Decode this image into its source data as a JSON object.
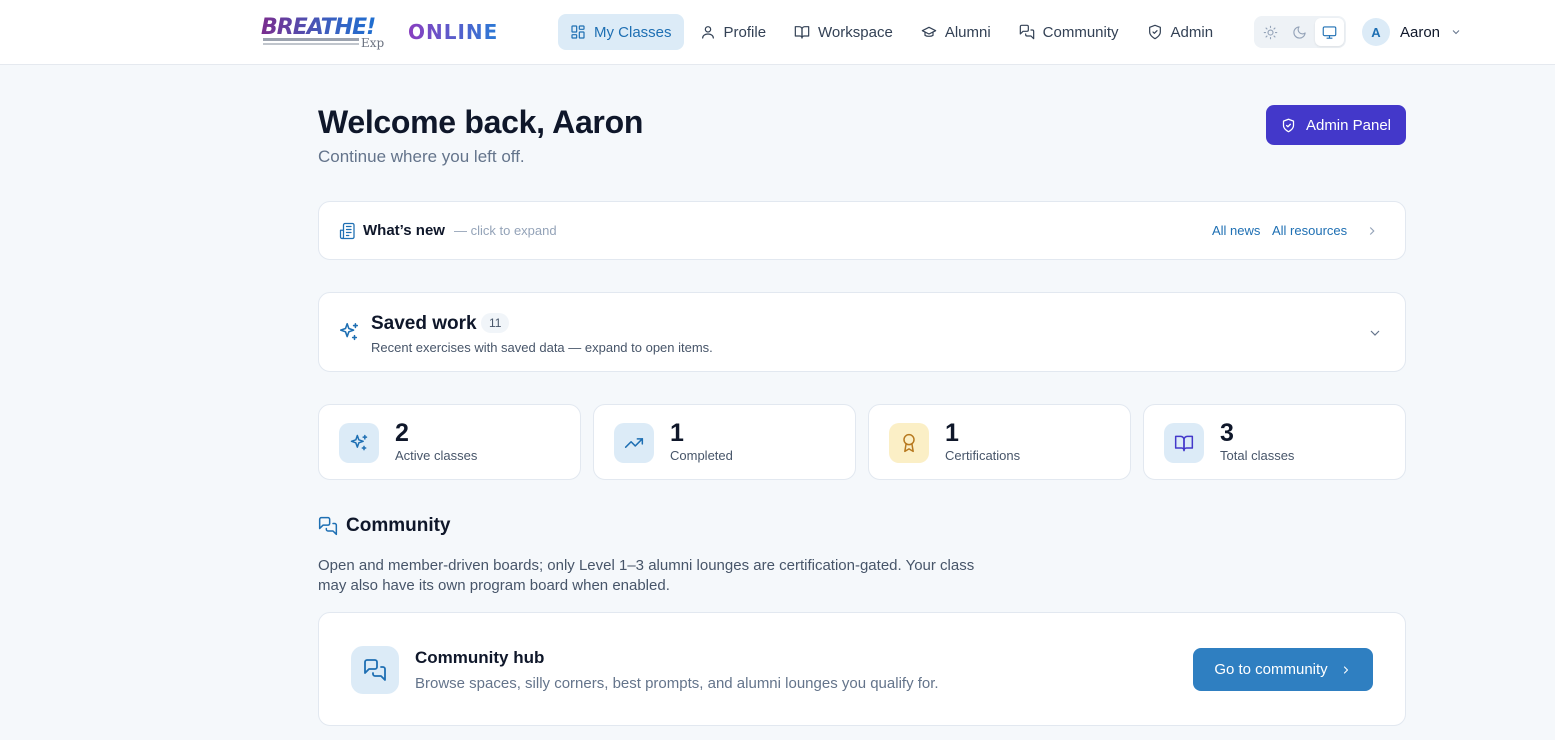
{
  "brand": {
    "logo_text": "BREATHE!",
    "logo_sub": "Exp",
    "online_text": "ONLINE"
  },
  "nav": {
    "items": [
      {
        "label": "My Classes",
        "icon": "grid-icon",
        "active": true
      },
      {
        "label": "Profile",
        "icon": "user-icon",
        "active": false
      },
      {
        "label": "Workspace",
        "icon": "book-open-icon",
        "active": false
      },
      {
        "label": "Alumni",
        "icon": "graduation-cap-icon",
        "active": false
      },
      {
        "label": "Community",
        "icon": "chat-icon",
        "active": false
      },
      {
        "label": "Admin",
        "icon": "shield-icon",
        "active": false
      }
    ]
  },
  "theme_switch": {
    "options": [
      "light",
      "dark",
      "system"
    ],
    "selected": "system"
  },
  "user": {
    "initial": "A",
    "name": "Aaron"
  },
  "welcome": {
    "title": "Welcome back, Aaron",
    "subtitle": "Continue where you left off."
  },
  "admin_button": {
    "label": "Admin Panel"
  },
  "whats_new": {
    "title": "What’s new",
    "hint": "— click to expand",
    "links": [
      "All news",
      "All resources"
    ]
  },
  "saved_work": {
    "title": "Saved work",
    "count": "11",
    "subtitle": "Recent exercises with saved data — expand to open items."
  },
  "stats": [
    {
      "value": "2",
      "label": "Active classes",
      "icon": "sparkles-icon",
      "color": "#1e6fb3",
      "bg": "#dcebf7"
    },
    {
      "value": "1",
      "label": "Completed",
      "icon": "trending-up-icon",
      "color": "#1e6fb3",
      "bg": "#dcebf7"
    },
    {
      "value": "1",
      "label": "Certifications",
      "icon": "award-icon",
      "color": "#b7791f",
      "bg": "#fbefc6"
    },
    {
      "value": "3",
      "label": "Total classes",
      "icon": "book-open-icon",
      "color": "#4338ca",
      "bg": "#dcebf7"
    }
  ],
  "community": {
    "heading": "Community",
    "description": "Open and member-driven boards; only Level 1–3 alumni lounges are certification-gated. Your class may also have its own program board when enabled.",
    "hub_title": "Community hub",
    "hub_subtitle": "Browse spaces, silly corners, best prompts, and alumni lounges you qualify for.",
    "hub_button": "Go to community"
  },
  "colors": {
    "primary": "#1e6fb3",
    "admin": "#4338ca",
    "background": "#f5f8fb"
  }
}
